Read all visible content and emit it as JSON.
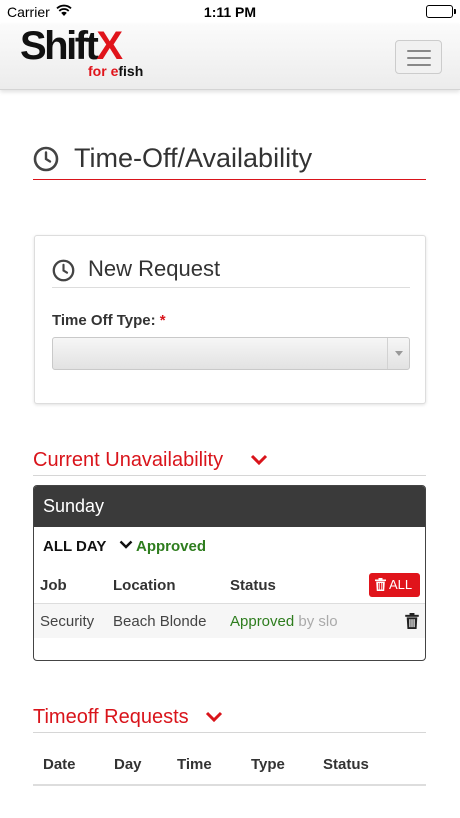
{
  "status_bar": {
    "carrier": "Carrier",
    "time": "1:11 PM"
  },
  "header": {
    "logo_main": "Shift",
    "logo_x": "X",
    "logo_sub_prefix": "for ",
    "logo_sub_e": "e",
    "logo_sub_fish": "fish",
    "menu_icon": "hamburger-menu-icon"
  },
  "page": {
    "title": "Time-Off/Availability",
    "title_icon": "clock-icon"
  },
  "new_request": {
    "title": "New Request",
    "title_icon": "clock-icon",
    "time_off_type_label": "Time Off Type:",
    "required_marker": "*",
    "time_off_type_value": ""
  },
  "current_unavailability": {
    "title": "Current Unavailability",
    "toggle_icon": "chevron-down-icon",
    "days": [
      {
        "day": "Sunday",
        "range": "ALL DAY",
        "status": "Approved",
        "columns": [
          "Job",
          "Location",
          "Status"
        ],
        "delete_all_label": "ALL",
        "rows": [
          {
            "job": "Security",
            "location": "Beach Blonde",
            "status": "Approved",
            "by": "by slo"
          }
        ]
      }
    ]
  },
  "timeoff_requests": {
    "title": "Timeoff Requests",
    "toggle_icon": "chevron-down-icon",
    "columns": [
      "Date",
      "Day",
      "Time",
      "Type",
      "Status"
    ]
  },
  "colors": {
    "brand_red": "#e0141b",
    "section_red": "#d9141b",
    "approved_green": "#2e7d1e",
    "day_header": "#3a3a3a"
  }
}
